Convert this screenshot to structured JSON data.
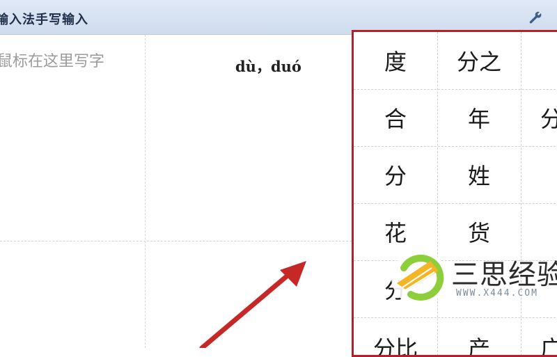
{
  "window": {
    "title": "输入法手写输入"
  },
  "pad": {
    "hint": "鼠标在这里写字",
    "pinyin": "dù，duó"
  },
  "candidates": {
    "rows": [
      [
        "度",
        "分之",
        ""
      ],
      [
        "合",
        "年",
        "分"
      ],
      [
        "分",
        "姓",
        ""
      ],
      [
        "花",
        "货",
        ""
      ],
      [
        "分",
        "",
        ""
      ],
      [
        "分比",
        "产",
        "广"
      ]
    ]
  },
  "watermark": {
    "text": "三思经验",
    "url": "WWW.X444.COM"
  },
  "colors": {
    "highlight_border": "#b3202a",
    "titlebar": "#d6e2f2",
    "arrow": "#c62828"
  }
}
